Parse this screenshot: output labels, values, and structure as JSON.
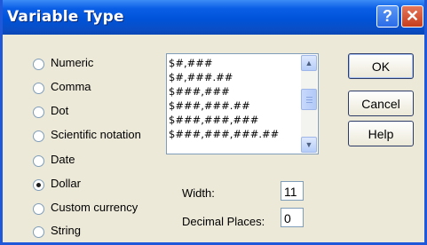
{
  "window": {
    "title": "Variable Type",
    "help_button": "?",
    "close_button": "✕"
  },
  "radio_options": [
    {
      "label": "Numeric",
      "checked": false
    },
    {
      "label": "Comma",
      "checked": false
    },
    {
      "label": "Dot",
      "checked": false
    },
    {
      "label": "Scientific notation",
      "checked": false
    },
    {
      "label": "Date",
      "checked": false
    },
    {
      "label": "Dollar",
      "checked": true
    },
    {
      "label": "Custom currency",
      "checked": false
    },
    {
      "label": "String",
      "checked": false
    }
  ],
  "format_list": {
    "items": [
      "$#,###",
      "$#,###.##",
      "$###,###",
      "$###,###.##",
      "$###,###,###",
      "$###,###,###.##"
    ]
  },
  "buttons": {
    "ok": "OK",
    "cancel": "Cancel",
    "help": "Help"
  },
  "fields": {
    "width_label": "Width:",
    "width_value": "11",
    "decimal_label": "Decimal Places:",
    "decimal_value": "0"
  }
}
